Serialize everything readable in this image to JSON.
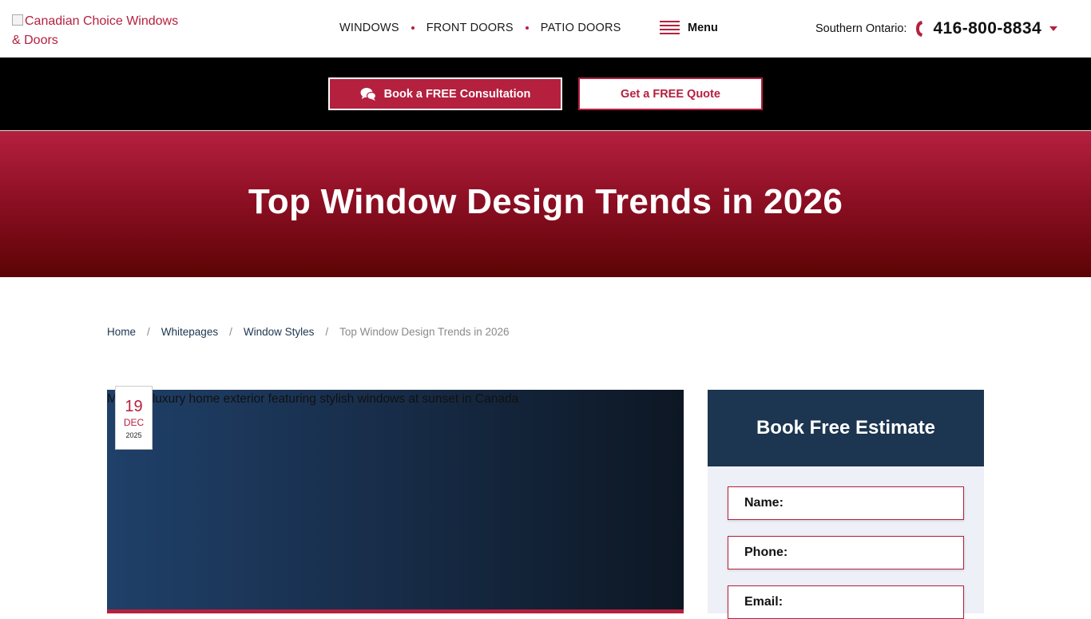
{
  "header": {
    "logo_alt": "Canadian Choice Windows & Doors",
    "nav": [
      "WINDOWS",
      "FRONT DOORS",
      "PATIO DOORS"
    ],
    "menu_label": "Menu",
    "region_label": "Southern Ontario:",
    "phone": "416-800-8834"
  },
  "cta": {
    "consult_label": "Book a FREE Consultation",
    "quote_label": "Get a FREE Quote"
  },
  "hero": {
    "title": "Top Window Design Trends in 2026"
  },
  "breadcrumb": {
    "items": [
      "Home",
      "Whitepages",
      "Window Styles"
    ],
    "current": "Top Window Design Trends in 2026"
  },
  "article": {
    "image_alt": "Modern luxury home exterior featuring stylish windows at sunset in Canada",
    "date": {
      "day": "19",
      "month": "DEC",
      "year": "2025"
    }
  },
  "estimate": {
    "title": "Book Free Estimate",
    "fields": [
      "Name:",
      "Phone:",
      "Email:"
    ]
  },
  "colors": {
    "accent": "#b5203f",
    "navy": "#1c3550",
    "hero_dark": "#5c0404"
  }
}
